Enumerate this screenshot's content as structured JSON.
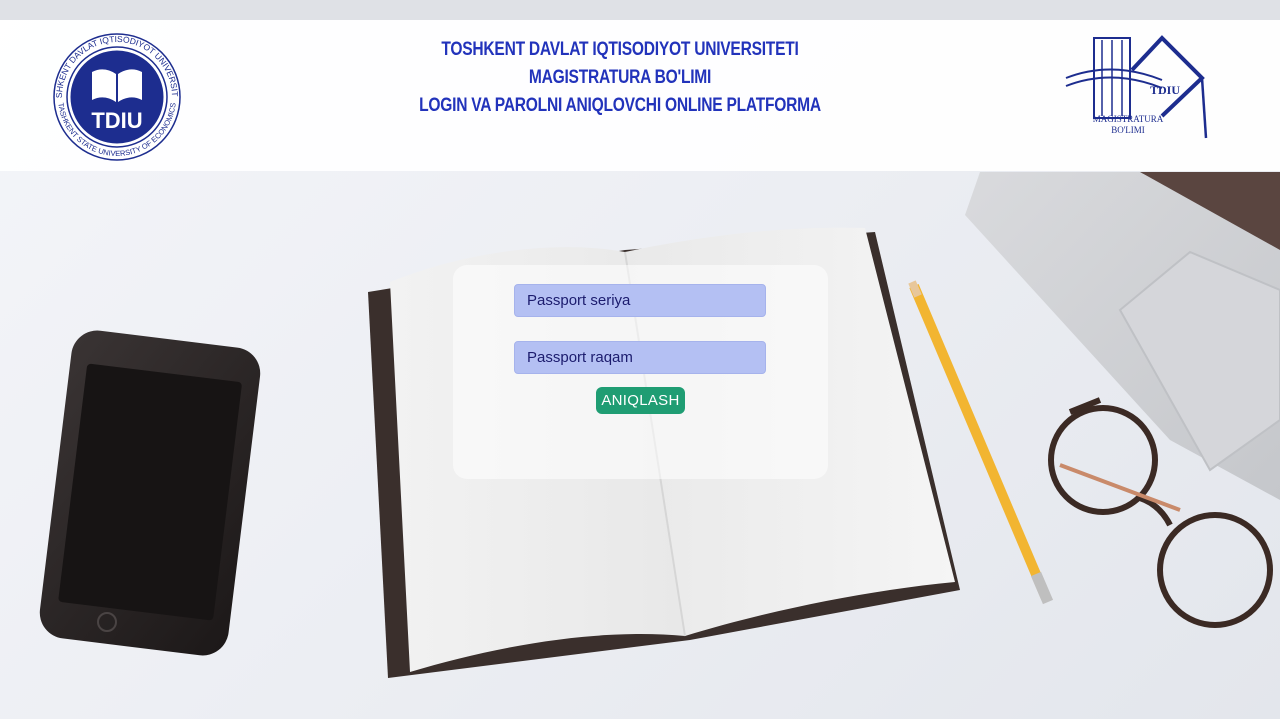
{
  "header": {
    "line1": "TOSHKENT DAVLAT IQTISODIYOT UNIVERSITETI",
    "line2": "MAGISTRATURA BO'LIMI",
    "line3": "LOGIN VA PAROLNI ANIQLOVCHI ONLINE PLATFORMA"
  },
  "logo_left": {
    "abbr": "TDIU",
    "ring_top": "TOSHKENT DAVLAT IQTISODIYOT UNIVERSITETI",
    "ring_bottom": "TASHKENT STATE UNIVERSITY OF ECONOMICS"
  },
  "logo_right": {
    "abbr": "TDIU",
    "line1": "MAGISTRATURA",
    "line2": "BO'LIMI"
  },
  "form": {
    "seriya_placeholder": "Passport seriya",
    "raqam_placeholder": "Passport raqam",
    "submit_label": "ANIQLASH"
  },
  "colors": {
    "brand_blue": "#2233bb",
    "input_bg": "#b4c0f3",
    "button_green": "#1f9d73"
  }
}
